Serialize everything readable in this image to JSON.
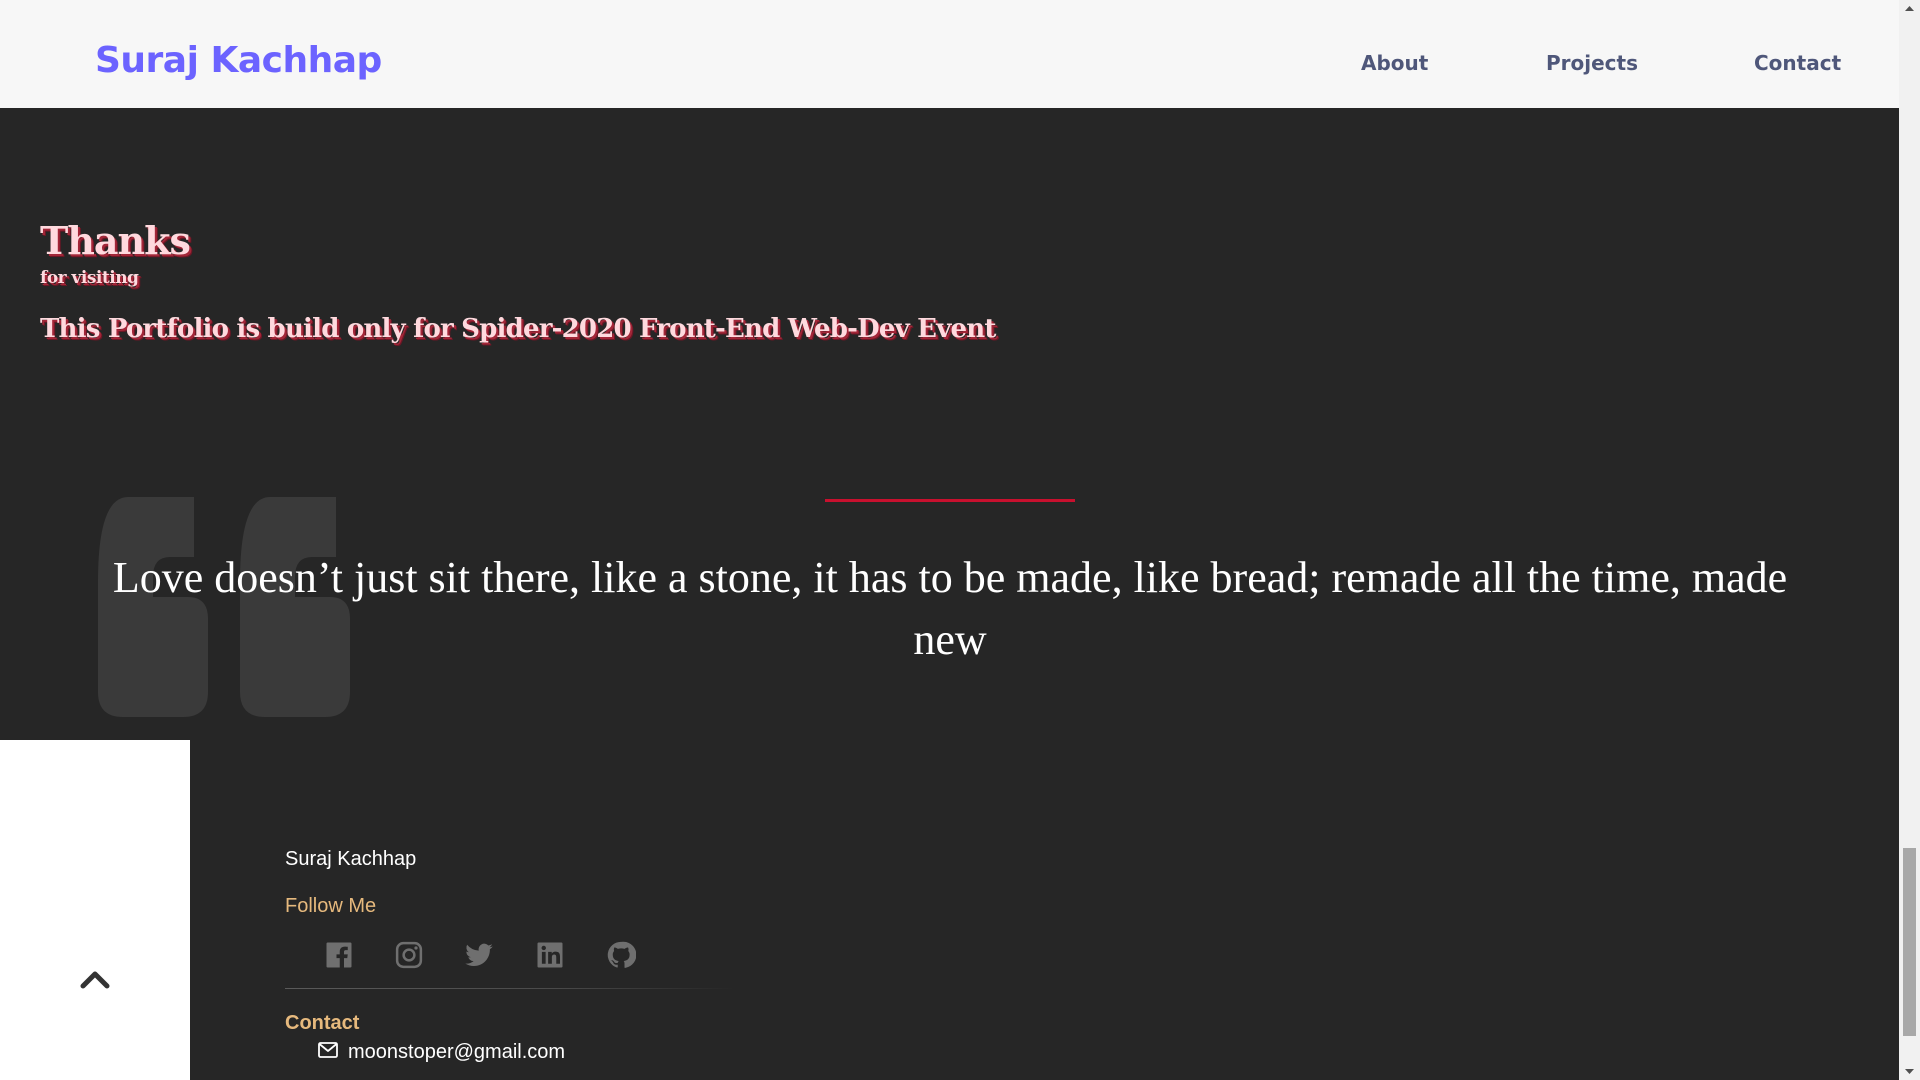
{
  "header": {
    "brand": "Suraj Kachhap",
    "nav": [
      "About",
      "Projects",
      "Contact"
    ]
  },
  "thanks": {
    "title": "Thanks",
    "subtitle": "for visiting",
    "note": "This Portfolio is build only for Spider-2020 Front-End Web-Dev Event"
  },
  "quote": {
    "text": "Love doesn’t just sit there, like a stone, it has to be made, like bread; remade all the time, made new"
  },
  "footer": {
    "name": "Suraj Kachhap",
    "follow_label": "Follow Me",
    "social_icons": [
      "facebook-icon",
      "instagram-icon",
      "twitter-icon",
      "linkedin-icon",
      "github-icon"
    ],
    "contact_label": "Contact",
    "email": "moonstoper@gmail.com"
  },
  "colors": {
    "brand": "#6c63ff",
    "nav_text": "#4f577a",
    "background_dark": "#262626",
    "quote_accent": "#c8102e",
    "footer_accent": "#e6b97d"
  }
}
